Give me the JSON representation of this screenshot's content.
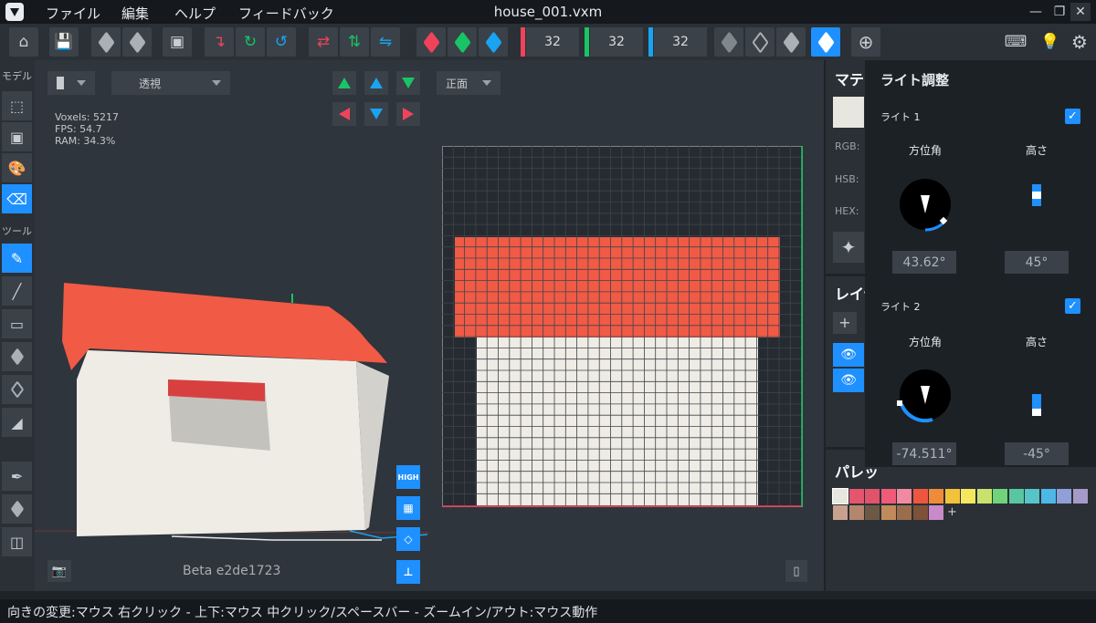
{
  "app": {
    "title": "house_001.vxm",
    "menu": [
      "ファイル",
      "編集",
      "ヘルプ",
      "フィードバック"
    ],
    "window_controls": [
      "minimize-icon",
      "maximize-icon",
      "close-icon"
    ]
  },
  "toolbar": {
    "dims": {
      "x": "32",
      "y": "32",
      "z": "32"
    },
    "dim_colors": {
      "x": "#f0435a",
      "y": "#19c464",
      "z": "#1aa3f0"
    },
    "icons": [
      "home-icon",
      "save-icon",
      "export-icon",
      "import-icon",
      "crop-icon",
      "mirror-icon",
      "rotate-icon",
      "flip-icon",
      "swap-icon",
      "transpose-icon",
      "shuffle-icon",
      "red-cube-icon",
      "green-cube-icon",
      "blue-cube-icon",
      "wire-cube-icon",
      "wire-cube-icon-2",
      "solid-cube-icon",
      "hex-cube-icon",
      "target-icon",
      "keyboard-icon",
      "light-icon",
      "settings-icon"
    ]
  },
  "left": {
    "model_label": "モデル",
    "tool_label": "ツール"
  },
  "viewport": {
    "view_mode": "",
    "projection": "透視",
    "orientation": "正面",
    "stats": {
      "voxels": "Voxels: 5217",
      "fps": "FPS: 54.7",
      "ram": "RAM: 34.3%"
    },
    "quality_label": "HIGH",
    "beta": "Beta e2de1723"
  },
  "right_panel": {
    "material_title": "マテリ",
    "material_color": "#e8e7df",
    "rgb_label": "RGB:",
    "hsb_label": "HSB:",
    "hex_label": "HEX:",
    "layer_title": "レイヤ",
    "palette_title": "パレッ",
    "palette": [
      "#e8e7df",
      "#e3566d",
      "#e0536a",
      "#f05b7a",
      "#f08aa0",
      "#ef563f",
      "#f08b3a",
      "#f2c23a",
      "#f5e860",
      "#c8e36c",
      "#6fd47a",
      "#58c6a0",
      "#57c4c8",
      "#4cb8e8",
      "#8fa0d8",
      "#a69ac8",
      "#c9a28f",
      "#b4866c",
      "#6d5844",
      "#c08a5a",
      "#9a6e4c",
      "#7e5236",
      "#c88ac8"
    ]
  },
  "light": {
    "title": "ライト調整",
    "light1": {
      "label": "ライト 1",
      "enabled": true,
      "azimuth_label": "方位角",
      "height_label": "高さ",
      "azimuth": "43.62°",
      "height": "45°"
    },
    "light2": {
      "label": "ライト 2",
      "enabled": true,
      "azimuth_label": "方位角",
      "height_label": "高さ",
      "azimuth": "-74.511°",
      "height": "-45°"
    }
  },
  "status": {
    "text": "向きの変更:マウス 右クリック - 上下:マウス 中クリック/スペースバー - ズームイン/アウト:マウス動作"
  },
  "scene": {
    "roof_color": "#f15a45",
    "wall_color": "#eeece5",
    "window_color": "#c4c2bd",
    "window_top_color": "#d84040"
  }
}
